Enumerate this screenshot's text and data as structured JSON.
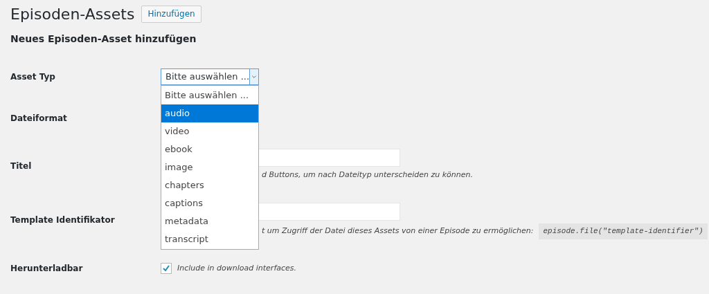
{
  "page_title": "Episoden-Assets",
  "add_button": "Hinzufügen",
  "form_heading": "Neues Episoden-Asset hinzufügen",
  "fields": [
    {
      "kind": "select",
      "label": "Asset Typ",
      "value": "Bitte auswählen ...",
      "expanded": true,
      "options": [
        {
          "label": "Bitte auswählen ...",
          "highlighted": false
        },
        {
          "label": "audio",
          "highlighted": true
        },
        {
          "label": "video",
          "highlighted": false
        },
        {
          "label": "ebook",
          "highlighted": false
        },
        {
          "label": "image",
          "highlighted": false
        },
        {
          "label": "chapters",
          "highlighted": false
        },
        {
          "label": "captions",
          "highlighted": false
        },
        {
          "label": "metadata",
          "highlighted": false
        },
        {
          "label": "transcript",
          "highlighted": false
        }
      ]
    },
    {
      "kind": "hidden",
      "label": "Dateiformat"
    },
    {
      "kind": "text",
      "label": "Titel",
      "description": "d Buttons, um nach Dateityp unterscheiden zu können."
    },
    {
      "kind": "text",
      "label": "Template Identifikator",
      "description": "t um Zugriff der Datei dieses Assets von einer Episode zu ermöglichen:",
      "code": "episode.file(\"template-identifier\")"
    },
    {
      "kind": "checkbox",
      "label": "Herunterladbar",
      "checked": true,
      "description": "Include in download interfaces."
    }
  ]
}
